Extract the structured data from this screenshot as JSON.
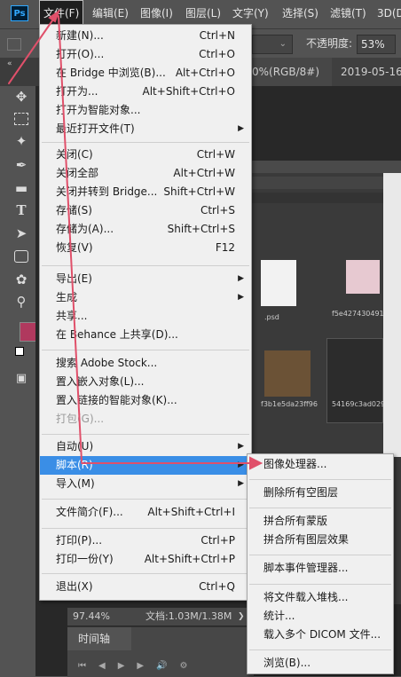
{
  "menubar": {
    "logo": "Ps",
    "items": [
      "文件(F)",
      "编辑(E)",
      "图像(I)",
      "图层(L)",
      "文字(Y)",
      "选择(S)",
      "滤镜(T)",
      "3D(D"
    ]
  },
  "options": {
    "opacity_label": "不透明度:",
    "opacity_value": "53%"
  },
  "tabs": [
    "0%(RGB/8#)",
    "2019-05-16."
  ],
  "status": {
    "zoom": "97.44%",
    "doc": "文档:1.03M/1.38M"
  },
  "timeline": {
    "title": "时间轴"
  },
  "inner_thumbs": [
    ".psd",
    "f5e4274304917",
    "f3b1e5da23ff96",
    "54169c3ad02937"
  ],
  "file_menu": [
    {
      "label": "新建(N)...",
      "shortcut": "Ctrl+N"
    },
    {
      "label": "打开(O)...",
      "shortcut": "Ctrl+O"
    },
    {
      "label": "在 Bridge 中浏览(B)...",
      "shortcut": "Alt+Ctrl+O"
    },
    {
      "label": "打开为...",
      "shortcut": "Alt+Shift+Ctrl+O"
    },
    {
      "label": "打开为智能对象...",
      "shortcut": ""
    },
    {
      "label": "最近打开文件(T)",
      "shortcut": ""
    },
    {
      "label": "关闭(C)",
      "shortcut": "Ctrl+W"
    },
    {
      "label": "关闭全部",
      "shortcut": "Alt+Ctrl+W"
    },
    {
      "label": "关闭并转到 Bridge...",
      "shortcut": "Shift+Ctrl+W"
    },
    {
      "label": "存储(S)",
      "shortcut": "Ctrl+S"
    },
    {
      "label": "存储为(A)...",
      "shortcut": "Shift+Ctrl+S"
    },
    {
      "label": "恢复(V)",
      "shortcut": "F12"
    },
    {
      "label": "导出(E)",
      "shortcut": ""
    },
    {
      "label": "生成",
      "shortcut": ""
    },
    {
      "label": "共享...",
      "shortcut": ""
    },
    {
      "label": "在 Behance 上共享(D)...",
      "shortcut": ""
    },
    {
      "label": "搜索 Adobe Stock...",
      "shortcut": ""
    },
    {
      "label": "置入嵌入对象(L)...",
      "shortcut": ""
    },
    {
      "label": "置入链接的智能对象(K)...",
      "shortcut": ""
    },
    {
      "label": "打包(G)...",
      "shortcut": ""
    },
    {
      "label": "自动(U)",
      "shortcut": ""
    },
    {
      "label": "脚本(R)",
      "shortcut": ""
    },
    {
      "label": "导入(M)",
      "shortcut": ""
    },
    {
      "label": "文件简介(F)...",
      "shortcut": "Alt+Shift+Ctrl+I"
    },
    {
      "label": "打印(P)...",
      "shortcut": "Ctrl+P"
    },
    {
      "label": "打印一份(Y)",
      "shortcut": "Alt+Shift+Ctrl+P"
    },
    {
      "label": "退出(X)",
      "shortcut": "Ctrl+Q"
    }
  ],
  "script_menu": [
    {
      "label": "图像处理器..."
    },
    {
      "label": "删除所有空图层"
    },
    {
      "label": "拼合所有蒙版"
    },
    {
      "label": "拼合所有图层效果"
    },
    {
      "label": "脚本事件管理器..."
    },
    {
      "label": "将文件载入堆栈..."
    },
    {
      "label": "统计..."
    },
    {
      "label": "载入多个 DICOM 文件..."
    },
    {
      "label": "浏览(B)..."
    }
  ],
  "colors": {
    "foreground": "#b0395e",
    "highlight": "#3a8ee6",
    "annotation_arrow": "#e0506a"
  }
}
